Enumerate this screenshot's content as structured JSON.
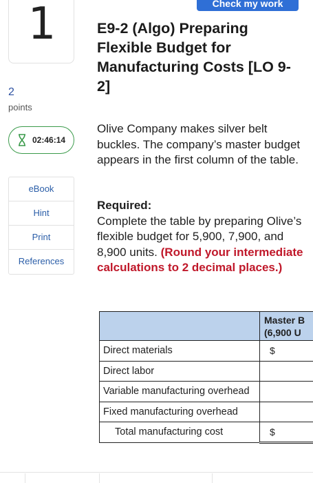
{
  "header": {
    "check_button_label": "Check my work"
  },
  "question": {
    "number": "1",
    "points_value": "2",
    "points_label": "points"
  },
  "timer": {
    "time": "02:46:14",
    "icon": "hourglass-icon"
  },
  "side_menu": {
    "items": [
      "eBook",
      "Hint",
      "Print",
      "References"
    ]
  },
  "title": "E9-2 (Algo) Preparing Flexible Budget for Manufacturing Costs [LO 9-2]",
  "body": {
    "intro": "Olive Company makes silver belt buckles. The company’s master budget appears in the first column of the table.",
    "required_label": "Required:",
    "required_text": "Complete the table by preparing Olive’s flexible budget for 5,900, 7,900, and 8,900 units.",
    "round_note": "(Round your intermediate calculations to 2 decimal places.)"
  },
  "table": {
    "header_line1": "Master B",
    "header_line2": "(6,900 U",
    "rows": [
      {
        "label": "Direct materials",
        "value": "$"
      },
      {
        "label": "Direct labor",
        "value": ""
      },
      {
        "label": "Variable manufacturing overhead",
        "value": ""
      },
      {
        "label": "Fixed manufacturing overhead",
        "value": ""
      },
      {
        "label": "Total manufacturing cost",
        "value": "$"
      }
    ]
  },
  "colors": {
    "accent": "#2f6fd6",
    "timer_border": "#3a9a4a",
    "table_header": "#bcd2ec",
    "note_red": "#c0182a"
  }
}
